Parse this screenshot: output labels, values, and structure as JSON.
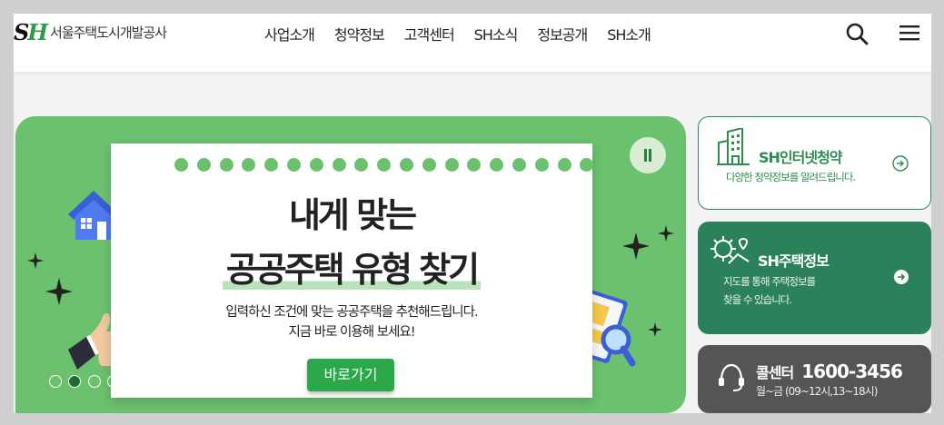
{
  "logo": {
    "mark_s": "S",
    "mark_h": "H",
    "text": "서울주택도시개발공사"
  },
  "nav": [
    "사업소개",
    "청약정보",
    "고객센터",
    "SH소식",
    "정보공개",
    "SH소개"
  ],
  "icons": {
    "search": "search-icon",
    "menu": "hamburger-menu-icon"
  },
  "banner": {
    "title_line1": "내게 맞는",
    "title_line2": "공공주택 유형 찾기",
    "desc_line1": "입력하신 조건에 맞는 공공주택을 추천해드립니다.",
    "desc_line2": "지금 바로 이용해 보세요!",
    "button": "바로가기",
    "slide_count": 10,
    "active_slide": 2,
    "colors": {
      "background": "#6cc16f",
      "button": "#2aa84a"
    }
  },
  "cards": {
    "internet": {
      "title": "SH인터넷청약",
      "sub": "다양한 청약정보를 알려드립니다."
    },
    "housing": {
      "title": "SH주택정보",
      "sub1": "지도를 통해 주택정보를",
      "sub2": "찾을 수 있습니다."
    },
    "callcenter": {
      "label": "콜센터",
      "number": "1600-3456",
      "hours": "월~금 (09~12시,13~18시)"
    }
  },
  "colors": {
    "brand_green": "#2e9a4a",
    "card_green": "#2b8159",
    "card_gray": "#555555"
  }
}
